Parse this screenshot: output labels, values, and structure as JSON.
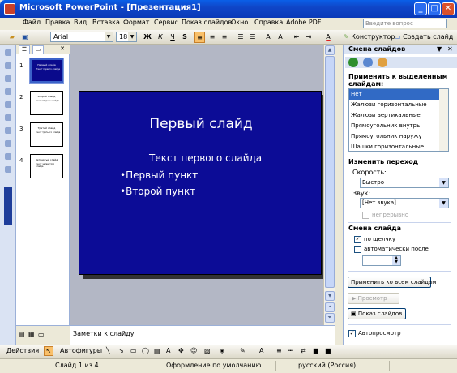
{
  "window": {
    "title": "Microsoft PowerPoint - [Презентация1]",
    "minimize": "_",
    "maximize": "□",
    "close": "✕"
  },
  "menu": {
    "items": [
      "Файл",
      "Правка",
      "Вид",
      "Вставка",
      "Формат",
      "Сервис",
      "Показ слайдов",
      "Окно",
      "Справка",
      "Adobe PDF"
    ],
    "help_placeholder": "Введите вопрос"
  },
  "toolbar": {
    "font_name": "Arial",
    "font_size": "18",
    "bold": "Ж",
    "italic": "К",
    "underline": "Ч",
    "shadow": "S",
    "font_color": "A",
    "design_label": "Конструктор",
    "new_slide_label": "Создать слайд"
  },
  "thumbnails": [
    {
      "num": "1",
      "title": "Первый слайд",
      "sub": "Текст первого слайда"
    },
    {
      "num": "2",
      "title": "Второй слайд",
      "sub": "Текст второго слайда"
    },
    {
      "num": "3",
      "title": "Третий слайд",
      "sub": "Текст третьего слайда"
    },
    {
      "num": "4",
      "title": "Четвертый слайд",
      "sub": "Текст четвертого слайда"
    }
  ],
  "slide": {
    "title": "Первый слайд",
    "subtitle": "Текст первого слайда",
    "bullets": [
      "•Первый пункт",
      "•Второй пункт"
    ]
  },
  "notes": {
    "placeholder": "Заметки к слайду"
  },
  "taskpane": {
    "title": "Смена слайдов",
    "apply_heading": "Применить к выделенным слайдам:",
    "transitions": [
      "Нет",
      "Жалюзи горизонтальные",
      "Жалюзи вертикальные",
      "Прямоугольник внутрь",
      "Прямоугольник наружу",
      "Шашки горизонтальные"
    ],
    "selected_transition": "Нет",
    "modify_heading": "Изменить переход",
    "speed_label": "Скорость:",
    "speed_value": "Быстро",
    "sound_label": "Звук:",
    "sound_value": "[Нет звука]",
    "loop_label": "непрерывно",
    "advance_heading": "Смена слайда",
    "on_click_label": "по щелчку",
    "auto_label": "автоматически после",
    "apply_all_label": "Применить ко всем слайдам",
    "preview_label": "Просмотр",
    "slideshow_label": "Показ слайдов",
    "autopreview_label": "Автопросмотр"
  },
  "drawbar": {
    "actions_label": "Действия",
    "autoshapes_label": "Автофигуры"
  },
  "status": {
    "slide_position": "Слайд 1 из 4",
    "design": "Оформление по умолчанию",
    "language": "русский (Россия)"
  },
  "colors": {
    "slide_background": "#0C0C96",
    "title_bar": "#0A5FE8",
    "selected_item": "#316AC5"
  }
}
